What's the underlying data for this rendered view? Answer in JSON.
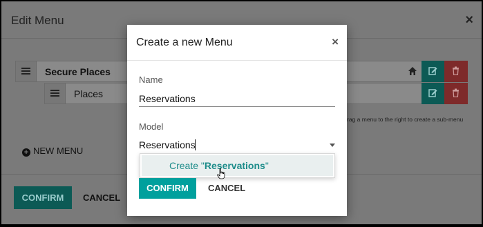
{
  "background_dialog": {
    "title": "Edit Menu",
    "close": "×",
    "rows": [
      {
        "label": "Secure Places"
      },
      {
        "label": "Places"
      }
    ],
    "hint": "rag a menu to the right to create a sub-menu",
    "new_menu": "NEW MENU",
    "confirm": "CONFIRM",
    "cancel": "CANCEL"
  },
  "modal": {
    "title": "Create a new Menu",
    "close": "×",
    "name_label": "Name",
    "name_value": "Reservations",
    "model_label": "Model",
    "model_value": "Reservations",
    "dropdown_prefix": "Create \"",
    "dropdown_value": "Reservations",
    "dropdown_suffix": "\"",
    "confirm": "CONFIRM",
    "cancel": "CANCEL"
  },
  "colors": {
    "primary": "#00a09d",
    "danger": "#d9534f",
    "overlay": "#7a7a7a"
  },
  "icons": [
    "drag-handle-icon",
    "home-icon",
    "edit-icon",
    "trash-icon",
    "plus-circle-icon",
    "close-icon",
    "caret-down-icon",
    "hand-cursor-icon"
  ]
}
